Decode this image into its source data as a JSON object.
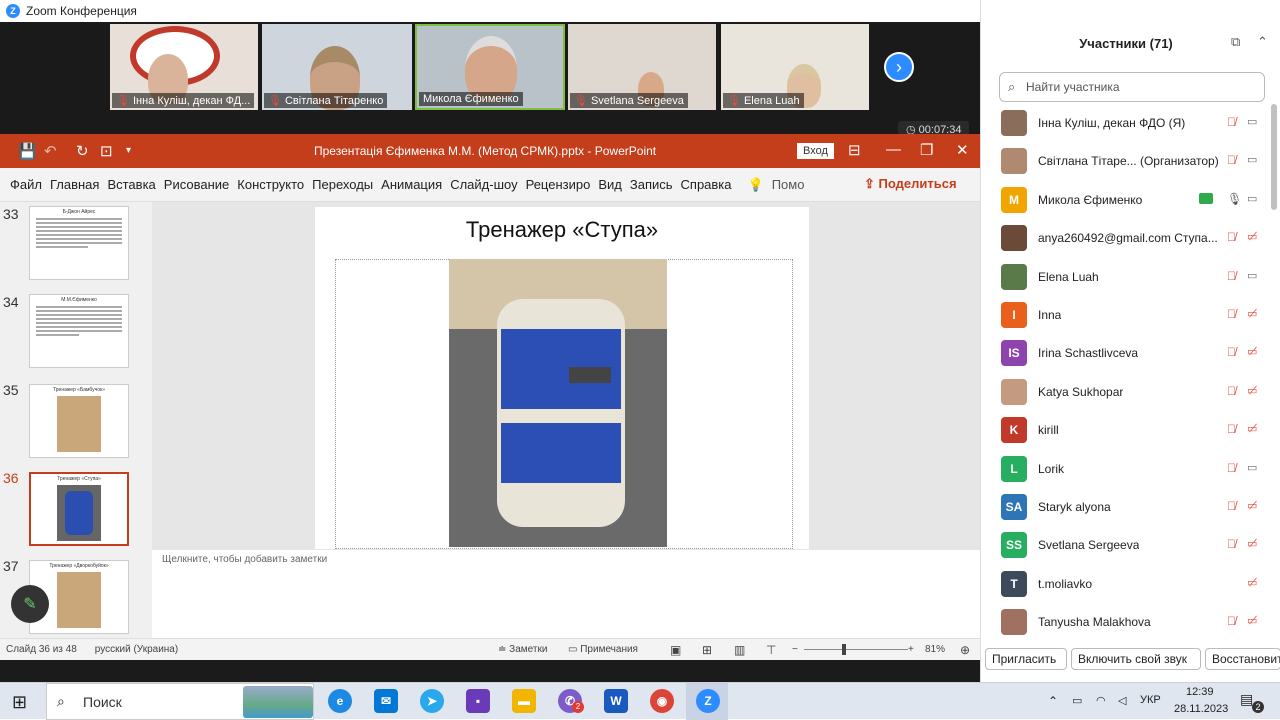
{
  "zoom": {
    "window_title": "Zoom Конференция",
    "videos": [
      {
        "name": "Інна Куліш, декан ФД..."
      },
      {
        "name": "Світлана Тітаренко"
      },
      {
        "name": "Микола Єфименко"
      },
      {
        "name": "Svetlana Sergeeva"
      },
      {
        "name": "Elena Luah"
      }
    ],
    "timer": "00:07:34"
  },
  "powerpoint": {
    "file_title": "Презентація Єфименка М.М. (Метод СРМК).pptx  -  PowerPoint",
    "login": "Вход",
    "tabs": [
      "Файл",
      "Главная",
      "Вставка",
      "Рисование",
      "Конструкто",
      "Переходы",
      "Анимация",
      "Слайд-шоу",
      "Рецензиро",
      "Вид",
      "Запись",
      "Справка"
    ],
    "tell_me": "Помо",
    "share": "Поделиться",
    "thumbnails": [
      {
        "num": "33",
        "title": "Б-Джон Айрес"
      },
      {
        "num": "34",
        "title": "М.М.Єфименко"
      },
      {
        "num": "35",
        "title": "Тренажер «Бамбучок»"
      },
      {
        "num": "36",
        "title": "Тренажер «Ступа»"
      },
      {
        "num": "37",
        "title": "Тренажер «Дворкобуйок»"
      }
    ],
    "slide_title": "Тренажер «Ступа»",
    "notes_placeholder": "Щелкните, чтобы добавить заметки",
    "status": {
      "slide": "Слайд 36 из 48",
      "language": "русский (Украина)",
      "notes": "Заметки",
      "comments": "Примечания",
      "zoom": "81%"
    }
  },
  "participants": {
    "title": "Участники (71)",
    "search_placeholder": "Найти участника",
    "list": [
      {
        "name": "Інна Куліш, декан ФДО (Я)",
        "initials": "",
        "color": "#8a6d5a",
        "mic": "muted",
        "cam": "on"
      },
      {
        "name": "Світлана Тітаре... (Организатор)",
        "initials": "",
        "color": "#b08a70",
        "mic": "muted",
        "cam": "on"
      },
      {
        "name": "Микола Єфименко",
        "initials": "М",
        "color": "#f0a500",
        "mic": "on",
        "cam": "on"
      },
      {
        "name": "anya260492@gmail.com Ступа...",
        "initials": "",
        "color": "#6b4a3a",
        "mic": "muted",
        "cam": "off"
      },
      {
        "name": "Elena Luah",
        "initials": "",
        "color": "#5a7a4a",
        "mic": "muted",
        "cam": "on"
      },
      {
        "name": "Inna",
        "initials": "I",
        "color": "#e8601c",
        "mic": "muted",
        "cam": "off"
      },
      {
        "name": "Irina Schastlivceva",
        "initials": "IS",
        "color": "#8e44ad",
        "mic": "muted",
        "cam": "off"
      },
      {
        "name": "Katya Sukhopar",
        "initials": "",
        "color": "#c49a80",
        "mic": "muted",
        "cam": "off"
      },
      {
        "name": "kirill",
        "initials": "K",
        "color": "#c0392b",
        "mic": "muted",
        "cam": "off"
      },
      {
        "name": "Lorik",
        "initials": "L",
        "color": "#27ae60",
        "mic": "muted",
        "cam": "on"
      },
      {
        "name": "Staryk alyona",
        "initials": "SA",
        "color": "#2e75b6",
        "mic": "muted",
        "cam": "off"
      },
      {
        "name": "Svetlana Sergeeva",
        "initials": "SS",
        "color": "#27ae60",
        "mic": "muted",
        "cam": "off"
      },
      {
        "name": "t.moliavko",
        "initials": "T",
        "color": "#3d4a5c",
        "mic": "none",
        "cam": "off"
      },
      {
        "name": "Tanyusha Malakhova",
        "initials": "",
        "color": "#a07060",
        "mic": "muted",
        "cam": "off"
      }
    ],
    "buttons": [
      "Пригласить",
      "Включить свой звук",
      "Восстановит"
    ]
  },
  "taskbar": {
    "search": "Поиск",
    "lang": "УКР",
    "time": "12:39",
    "date": "28.11.2023",
    "notif_count": "2",
    "badge_viber": "2"
  }
}
